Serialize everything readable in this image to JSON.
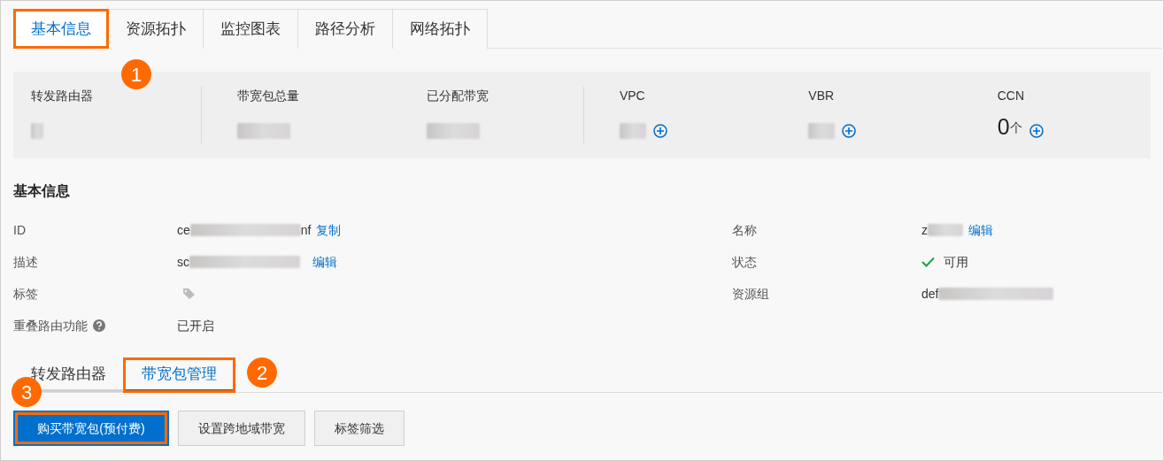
{
  "tabs": [
    {
      "label": "基本信息",
      "selected": true,
      "highlighted": true,
      "callout": "1"
    },
    {
      "label": "资源拓扑",
      "selected": false,
      "highlighted": false
    },
    {
      "label": "监控图表",
      "selected": false,
      "highlighted": false
    },
    {
      "label": "路径分析",
      "selected": false,
      "highlighted": false
    },
    {
      "label": "网络拓扑",
      "selected": false,
      "highlighted": false
    }
  ],
  "stats": [
    {
      "label": "转发路由器",
      "blurred": true,
      "add": false
    },
    {
      "label": "带宽包总量",
      "blurred": true,
      "add": false
    },
    {
      "label": "已分配带宽",
      "blurred": true,
      "add": false
    },
    {
      "label": "VPC",
      "blurred": true,
      "add": true
    },
    {
      "label": "VBR",
      "blurred": true,
      "add": true
    },
    {
      "label": "CCN",
      "blurred": false,
      "value": "0",
      "unit": "个",
      "add": true
    }
  ],
  "section_title": "基本信息",
  "fields_left": [
    {
      "label": "ID",
      "value_start": "ce",
      "value_end": "nf",
      "blurred": true,
      "action": "复制"
    },
    {
      "label": "描述",
      "value_start": "sc",
      "blurred": true,
      "action": "编辑"
    },
    {
      "label": "标签",
      "kind": "tag"
    },
    {
      "label": "重叠路由功能",
      "help": true,
      "value_start": "已开启",
      "blurred": false
    }
  ],
  "fields_right": [
    {
      "label": "名称",
      "value_start": "z",
      "blurred": true,
      "action": "编辑"
    },
    {
      "label": "状态",
      "kind": "status",
      "value_start": "可用",
      "blurred": false
    },
    {
      "label": "资源组",
      "value_start": "def",
      "blurred": true
    }
  ],
  "sub_tabs": [
    {
      "label": "转发路由器",
      "selected": false,
      "highlighted": false
    },
    {
      "label": "带宽包管理",
      "selected": true,
      "highlighted": true,
      "callout": "2"
    }
  ],
  "buttons": [
    {
      "label": "购买带宽包(预付费)",
      "kind": "primary",
      "highlighted": true,
      "callout": "3"
    },
    {
      "label": "设置跨地域带宽",
      "kind": "default",
      "highlighted": false
    },
    {
      "label": "标签筛选",
      "kind": "default",
      "highlighted": false
    }
  ]
}
